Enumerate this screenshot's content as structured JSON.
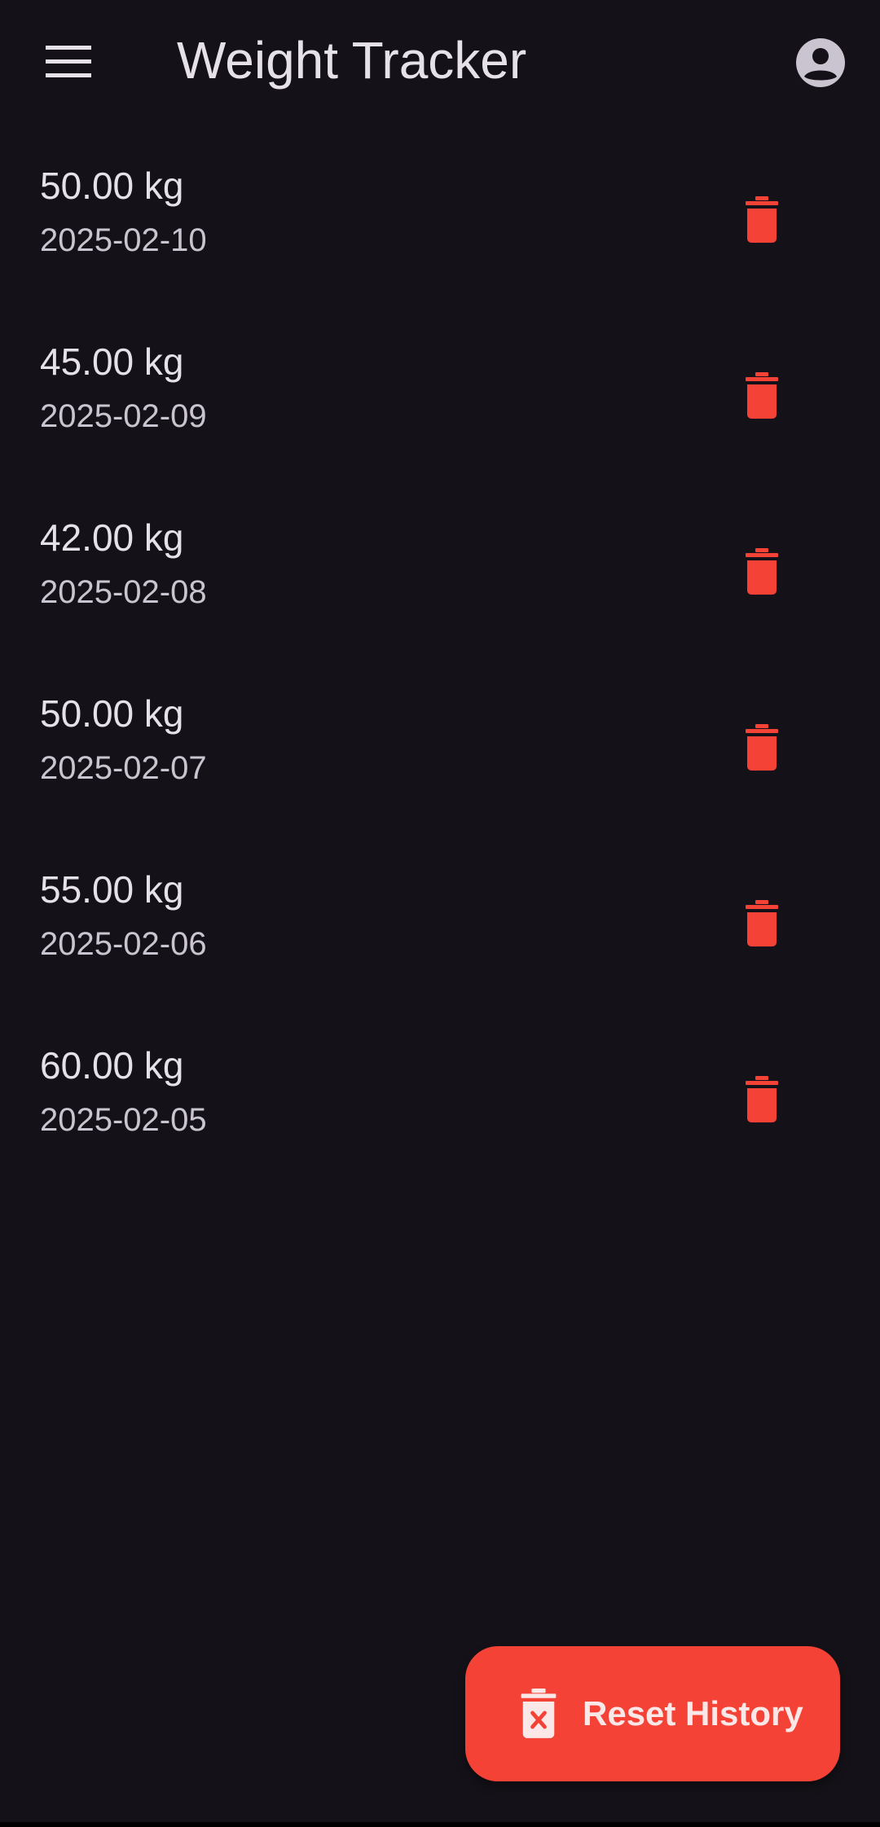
{
  "colors": {
    "background": "#141218",
    "text_primary": "#E6E0E9",
    "text_secondary": "#CAC4D0",
    "danger": "#F44336"
  },
  "appbar": {
    "title": "Weight Tracker",
    "menu_icon": "hamburger-menu-icon",
    "account_icon": "account-circle-icon"
  },
  "entries": [
    {
      "weight": "50.00 kg",
      "date": "2025-02-10"
    },
    {
      "weight": "45.00 kg",
      "date": "2025-02-09"
    },
    {
      "weight": "42.00 kg",
      "date": "2025-02-08"
    },
    {
      "weight": "50.00 kg",
      "date": "2025-02-07"
    },
    {
      "weight": "55.00 kg",
      "date": "2025-02-06"
    },
    {
      "weight": "60.00 kg",
      "date": "2025-02-05"
    }
  ],
  "fab": {
    "label": "Reset History",
    "icon": "delete-forever-icon"
  }
}
